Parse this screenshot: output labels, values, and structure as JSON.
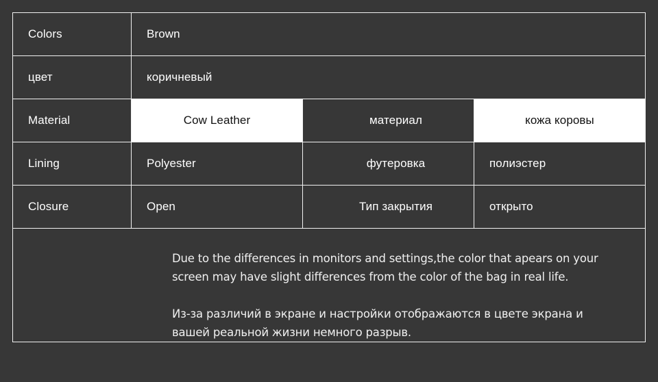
{
  "theme": {
    "background": "#373737",
    "cell_background": "#373737",
    "highlight_background": "#ffffff",
    "border_color": "#f2f2f2",
    "text_color": "#ffffff",
    "highlight_text_color": "#111111"
  },
  "spec_table": {
    "rows": [
      {
        "id": "colors",
        "label": "Colors",
        "value": "Brown",
        "label_ru": null,
        "value_ru": null,
        "highlight": false
      },
      {
        "id": "color-ru",
        "label": "цвет",
        "value": "коричневый",
        "label_ru": null,
        "value_ru": null,
        "highlight": false
      },
      {
        "id": "material",
        "label": "Material",
        "value": "Cow Leather",
        "label_ru": "материал",
        "value_ru": "кожа коровы",
        "highlight": true
      },
      {
        "id": "lining",
        "label": "Lining",
        "value": "Polyester",
        "label_ru": "футеровка",
        "value_ru": "полиэстер",
        "highlight": false
      },
      {
        "id": "closure",
        "label": "Closure",
        "value": "Open",
        "label_ru": "Тип закрытия",
        "value_ru": "открыто",
        "highlight": false
      }
    ]
  },
  "notice": {
    "paragraph_en": "Due to the differences in monitors and settings,the color that apears on your screen may have slight differences from the color of the bag in real life.",
    "paragraph_ru": "Из-за различий в экране и настройки отображаются в цвете экрана и вашей реальной жизни немного разрыв."
  }
}
